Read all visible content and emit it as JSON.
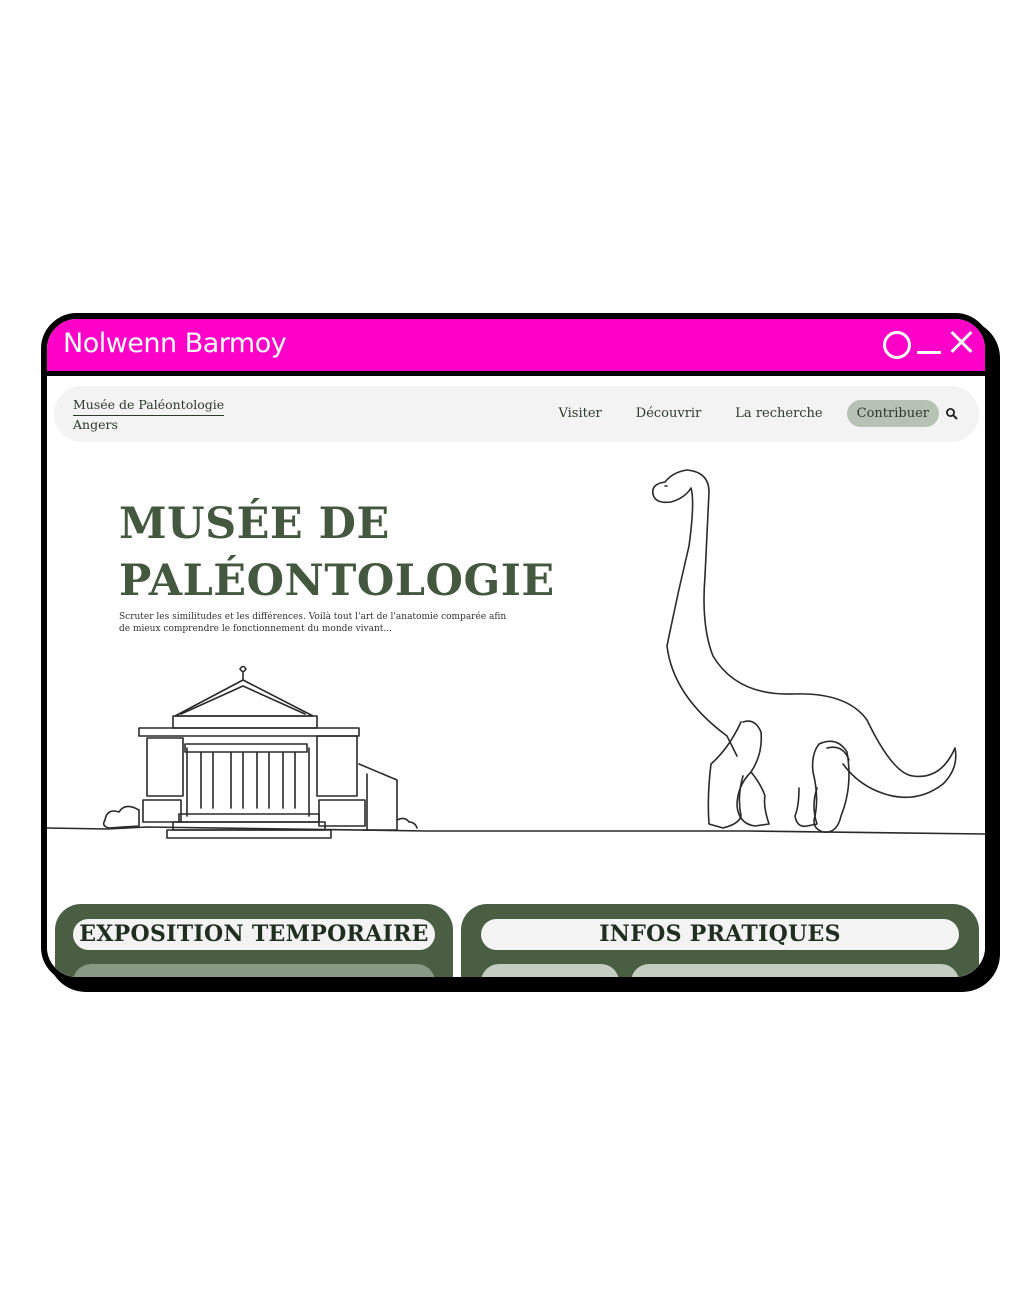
{
  "window": {
    "title": "Nolwenn Barmoy"
  },
  "navbar": {
    "brand_name": "Musée de Paléontologie",
    "brand_city": "Angers",
    "links": [
      "Visiter",
      "Découvrir",
      "La recherche",
      "Contribuer"
    ]
  },
  "hero": {
    "title_line1": "MUSÉE DE",
    "title_line2": "PALÉONTOLOGIE",
    "text": "Scruter les similitudes et les différences. Voilà tout l'art de l'anatomie comparée afin de mieux comprendre le fonctionnement du monde vivant..."
  },
  "cards": {
    "left_title": "EXPOSITION TEMPORAIRE",
    "right_title": "INFOS PRATIQUES"
  },
  "colors": {
    "titlebar": "#ff00c8",
    "accent_green": "#44583f",
    "card_green": "#4a5e44"
  }
}
